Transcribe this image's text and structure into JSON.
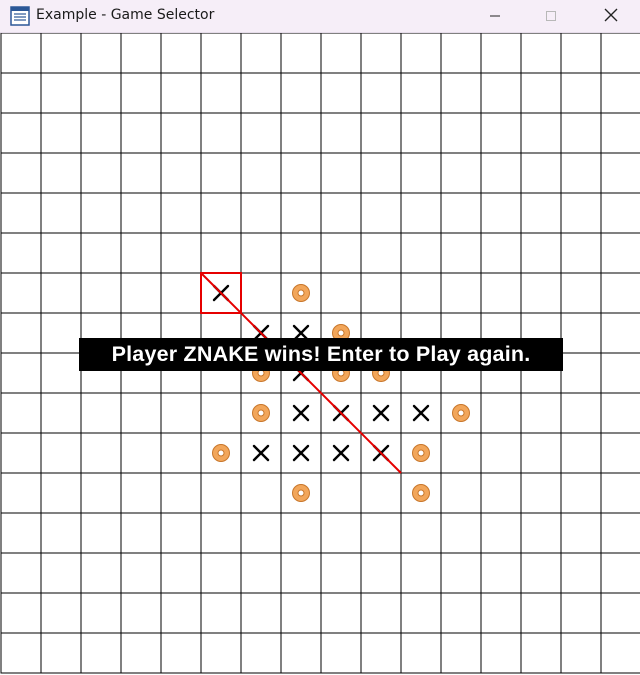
{
  "window": {
    "title": "Example - Game Selector",
    "icon": "app-window-icon",
    "controls": [
      "minimize-icon",
      "maximize-icon",
      "close-icon"
    ]
  },
  "board": {
    "columns": 16,
    "rows": 16,
    "line_color": "#000000",
    "x_color": "#000000",
    "o_fill": "#f2a65a",
    "o_stroke": "#c8762a",
    "highlight_color": "#e60000",
    "x_marks": [
      {
        "col": 5,
        "row": 6
      },
      {
        "col": 6,
        "row": 7
      },
      {
        "col": 7,
        "row": 7
      },
      {
        "col": 7,
        "row": 8
      },
      {
        "col": 7,
        "row": 9
      },
      {
        "col": 8,
        "row": 9
      },
      {
        "col": 9,
        "row": 9
      },
      {
        "col": 10,
        "row": 9
      },
      {
        "col": 6,
        "row": 10
      },
      {
        "col": 7,
        "row": 10
      },
      {
        "col": 8,
        "row": 10
      },
      {
        "col": 9,
        "row": 10
      }
    ],
    "o_marks": [
      {
        "col": 7,
        "row": 6
      },
      {
        "col": 8,
        "row": 7
      },
      {
        "col": 6,
        "row": 8
      },
      {
        "col": 8,
        "row": 8
      },
      {
        "col": 9,
        "row": 8
      },
      {
        "col": 6,
        "row": 9
      },
      {
        "col": 11,
        "row": 9
      },
      {
        "col": 5,
        "row": 10
      },
      {
        "col": 10,
        "row": 10
      },
      {
        "col": 7,
        "row": 11
      },
      {
        "col": 10,
        "row": 11
      }
    ],
    "last_move": {
      "col": 5,
      "row": 6
    },
    "win_line": {
      "from": {
        "col": 5,
        "row": 6
      },
      "to": {
        "col": 9,
        "row": 10
      }
    }
  },
  "banner": {
    "message": "Player ZNAKE wins! Enter to Play again."
  }
}
